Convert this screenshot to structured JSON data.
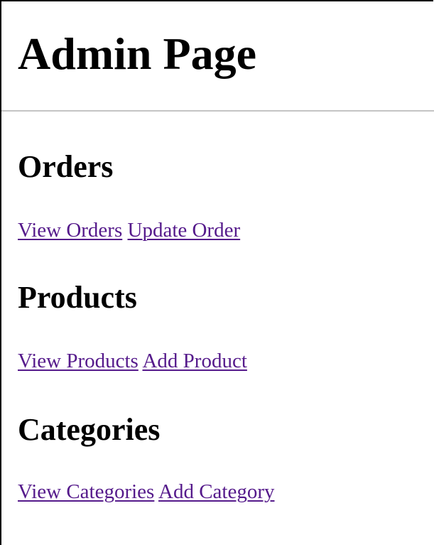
{
  "page": {
    "title": "Admin Page"
  },
  "sections": [
    {
      "title": "Orders",
      "links": [
        "View Orders",
        "Update Order"
      ]
    },
    {
      "title": "Products",
      "links": [
        "View Products",
        "Add Product"
      ]
    },
    {
      "title": "Categories",
      "links": [
        "View Categories",
        "Add Category"
      ]
    }
  ],
  "colors": {
    "link_visited": "#551a8b",
    "divider": "#c4c4c4",
    "text": "#000000",
    "background": "#ffffff"
  }
}
